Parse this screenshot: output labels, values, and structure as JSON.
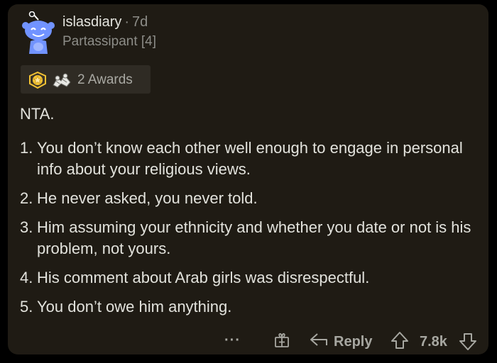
{
  "comment": {
    "username": "islasdiary",
    "separator": "·",
    "age": "7d",
    "flair": "Partassipant [4]",
    "awards_label": "2 Awards",
    "lead": "NTA.",
    "points": [
      {
        "num": "1.",
        "text": "You don’t know each other well enough to engage in personal info about your religious views."
      },
      {
        "num": "2.",
        "text": "He never asked, you never told."
      },
      {
        "num": "3.",
        "text": "Him assuming your ethnicity and whether you date or not is his problem, not yours."
      },
      {
        "num": "4.",
        "text": "His comment about Arab girls was disrespectful."
      },
      {
        "num": "5.",
        "text": "You don’t owe him anything."
      }
    ]
  },
  "toolbar": {
    "more_label": "···",
    "reply_label": "Reply",
    "score": "7.8k"
  },
  "colors": {
    "card_bg": "#1f1b14",
    "page_bg": "#000000",
    "muted_text": "#8d8d88",
    "award_gold": "#f2c233"
  },
  "icons": [
    "snoo-avatar-icon",
    "gold-award-icon",
    "wholesome-seal-award-icon",
    "more-options-icon",
    "gift-icon",
    "reply-arrow-icon",
    "upvote-arrow-icon",
    "downvote-arrow-icon"
  ]
}
